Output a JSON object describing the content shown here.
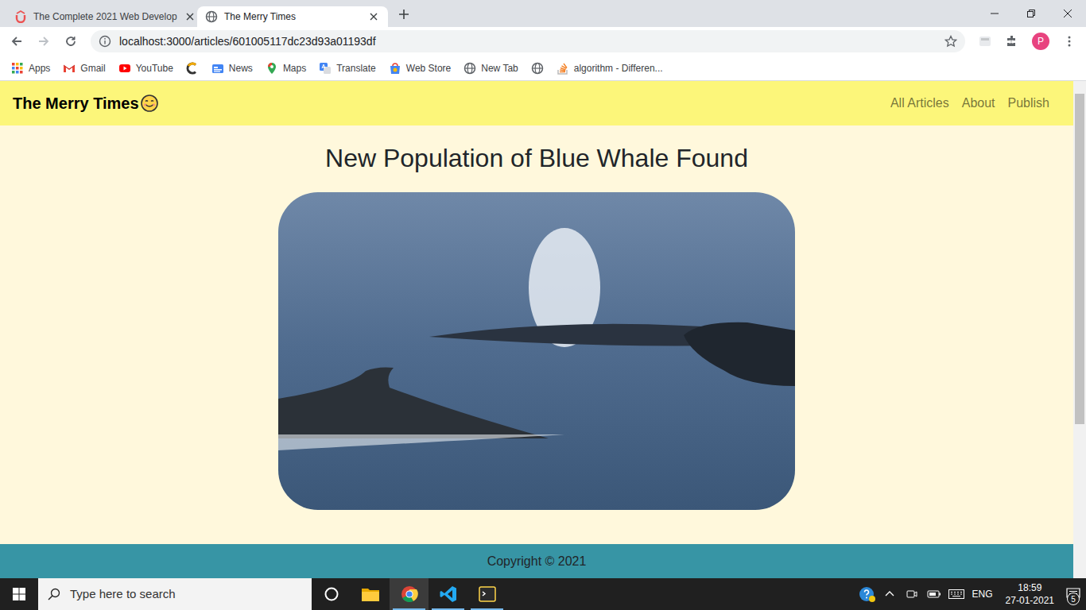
{
  "tabs": [
    {
      "label": "The Complete 2021 Web Develop",
      "selected": false
    },
    {
      "label": "The Merry Times",
      "selected": true
    }
  ],
  "address_bar": {
    "url": "localhost:3000/articles/601005117dc23d93a01193df"
  },
  "profile": {
    "initial": "P"
  },
  "bookmarks": [
    {
      "kind": "labeled",
      "label": "Apps"
    },
    {
      "kind": "labeled",
      "label": "Gmail"
    },
    {
      "kind": "labeled",
      "label": "YouTube"
    },
    {
      "kind": "icon-only"
    },
    {
      "kind": "labeled",
      "label": "News"
    },
    {
      "kind": "labeled",
      "label": "Maps"
    },
    {
      "kind": "labeled",
      "label": "Translate"
    },
    {
      "kind": "labeled",
      "label": "Web Store"
    },
    {
      "kind": "labeled",
      "label": "New Tab"
    },
    {
      "kind": "icon-only"
    },
    {
      "kind": "labeled",
      "label": "algorithm - Differen..."
    }
  ],
  "site": {
    "brand": "The Merry Times",
    "nav": [
      {
        "label": "All Articles"
      },
      {
        "label": "About"
      },
      {
        "label": "Publish"
      }
    ]
  },
  "article": {
    "title": "New Population of Blue Whale Found"
  },
  "footer": {
    "text": "Copyright © 2021"
  },
  "scrollbar": {
    "level": 0.7
  },
  "taskbar": {
    "search_placeholder": "Type here to search",
    "apps": [
      {
        "selected": false,
        "running": false
      },
      {
        "selected": false,
        "running": false
      },
      {
        "selected": true,
        "running": true
      },
      {
        "selected": false,
        "running": true
      },
      {
        "selected": false,
        "running": true
      }
    ]
  },
  "tray": {
    "language": "ENG",
    "time": "18:59",
    "date": "27-01-2021",
    "notifications": "5"
  }
}
